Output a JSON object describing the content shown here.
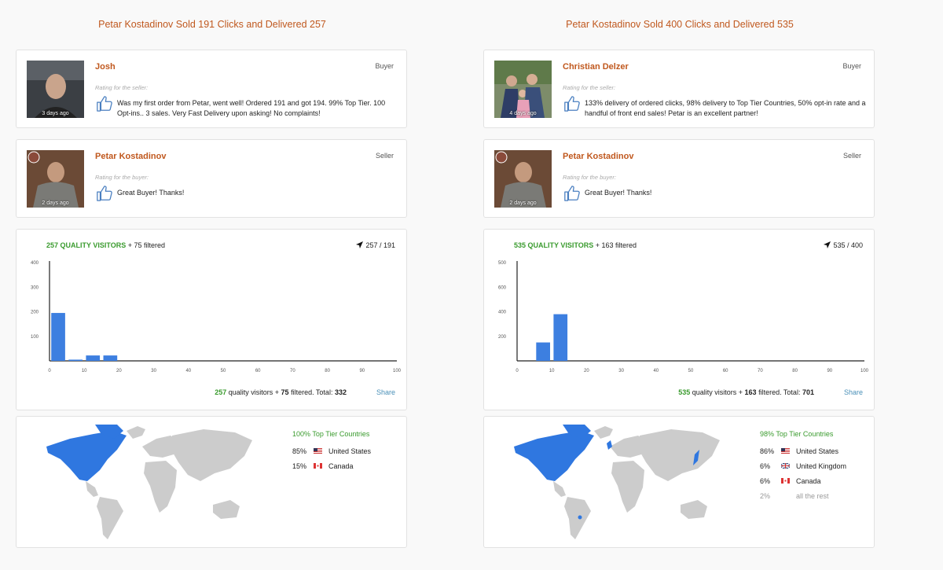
{
  "left": {
    "title": "Petar Kostadinov Sold 191 Clicks and Delivered 257",
    "buyer_review": {
      "name": "Josh",
      "role": "Buyer",
      "days": "3 days ago",
      "rating_label": "Rating for the seller:",
      "comment": "Was my first order from Petar, went well! Ordered 191 and got 194. 99% Top Tier. 100 Opt-ins.. 3 sales. Very Fast Delivery upon asking! No complaints!"
    },
    "seller_review": {
      "name": "Petar Kostadinov",
      "role": "Seller",
      "days": "2 days ago",
      "rating_label": "Rating for the buyer:",
      "comment": "Great Buyer! Thanks!"
    },
    "stats": {
      "quality_label": "257 QUALITY VISITORS",
      "filtered_label": "+ 75 filtered",
      "ratio": "257 / 191",
      "total_quality": "257",
      "total_quality_suffix": "quality visitors +",
      "total_filtered": "75",
      "total_filtered_suffix": "filtered. Total:",
      "total": "332",
      "share_label": "Share"
    },
    "countries": {
      "tier_label": "100% Top Tier Countries",
      "list": [
        {
          "pct": "85%",
          "flag": "us",
          "name": "United States"
        },
        {
          "pct": "15%",
          "flag": "ca",
          "name": "Canada"
        }
      ]
    }
  },
  "right": {
    "title": "Petar Kostadinov Sold 400 Clicks and Delivered 535",
    "buyer_review": {
      "name": "Christian Delzer",
      "role": "Buyer",
      "days": "4 days ago",
      "rating_label": "Rating for the seller:",
      "comment": "133% delivery of ordered clicks, 98% delivery to Top Tier Countries, 50% opt-in rate and a handful of front end sales! Petar is an excellent partner!"
    },
    "seller_review": {
      "name": "Petar Kostadinov",
      "role": "Seller",
      "days": "2 days ago",
      "rating_label": "Rating for the buyer:",
      "comment": "Great Buyer! Thanks!"
    },
    "stats": {
      "quality_label": "535 QUALITY VISITORS",
      "filtered_label": "+ 163 filtered",
      "ratio": "535 / 400",
      "total_quality": "535",
      "total_quality_suffix": "quality visitors +",
      "total_filtered": "163",
      "total_filtered_suffix": "filtered. Total:",
      "total": "701",
      "share_label": "Share"
    },
    "countries": {
      "tier_label": "98% Top Tier Countries",
      "list": [
        {
          "pct": "86%",
          "flag": "us",
          "name": "United States"
        },
        {
          "pct": "6%",
          "flag": "uk",
          "name": "United Kingdom"
        },
        {
          "pct": "6%",
          "flag": "ca",
          "name": "Canada"
        },
        {
          "pct": "2%",
          "flag": "",
          "name": "all the rest"
        }
      ]
    }
  },
  "colors": {
    "accent": "#c0581e",
    "green": "#3a9b2e",
    "bar": "#3d7fe0",
    "map_land": "#cccccc",
    "map_highlight": "#2f77e0",
    "link": "#4a90b8"
  },
  "chart_data": [
    {
      "type": "bar",
      "title": "",
      "xlabel": "",
      "ylabel": "",
      "xlim": [
        0,
        100
      ],
      "ylim": [
        0,
        400
      ],
      "xticks": [
        0,
        10,
        20,
        30,
        40,
        50,
        60,
        70,
        80,
        90,
        100
      ],
      "yticks": [
        100,
        200,
        300,
        400
      ],
      "x": [
        2.5,
        7.5,
        12.5,
        17.5
      ],
      "values": [
        195,
        5,
        22,
        22
      ],
      "bin_width": 4,
      "grid": false
    },
    {
      "type": "bar",
      "title": "",
      "xlabel": "",
      "ylabel": "",
      "xlim": [
        0,
        100
      ],
      "ylim": [
        0,
        800
      ],
      "xticks": [
        0,
        10,
        20,
        30,
        40,
        50,
        60,
        70,
        80,
        90,
        100
      ],
      "yticks": [
        200,
        400,
        600,
        800
      ],
      "ytick_labels": [
        "200",
        "400",
        "600",
        "500"
      ],
      "x": [
        7.5,
        12.5
      ],
      "values": [
        150,
        380
      ],
      "bin_width": 4,
      "grid": false
    }
  ]
}
